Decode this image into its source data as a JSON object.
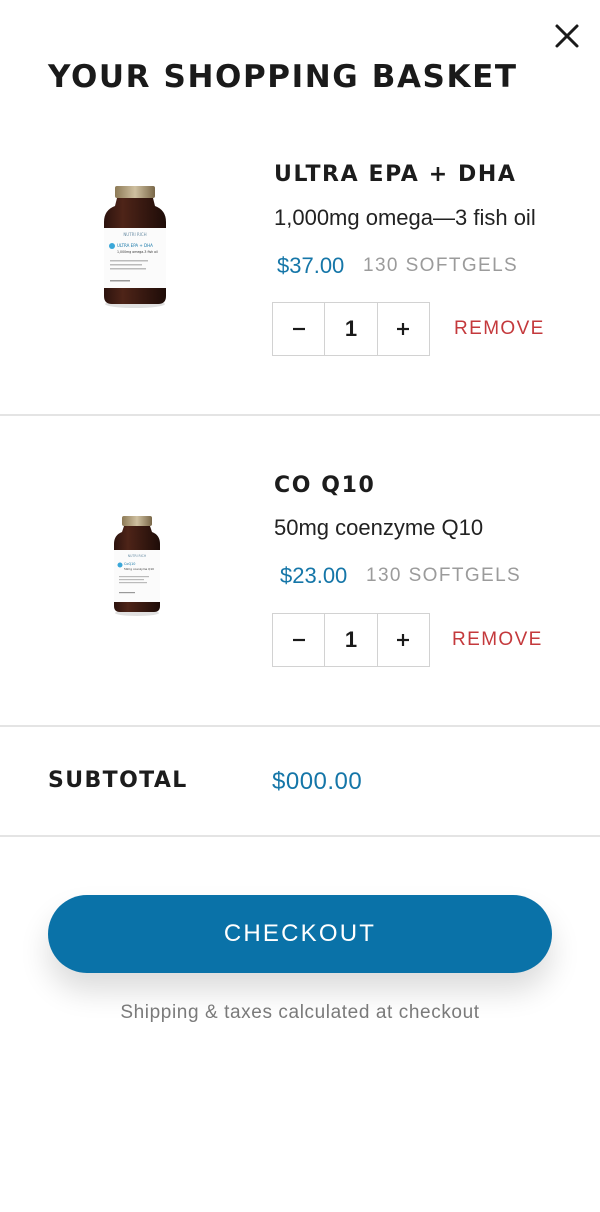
{
  "header": {
    "title": "YOUR SHOPPING BASKET",
    "close_icon": "close-icon"
  },
  "items": [
    {
      "name": "ULTRA EPA + DHA",
      "description": "1,000mg omega—3 fish oil",
      "price": "$37.00",
      "size": "130 SOFTGELS",
      "quantity": "1",
      "remove_label": "REMOVE",
      "image": {
        "brand": "NUTRI RICH",
        "label_name": "ULTRA EPA + DHA",
        "label_desc": "1,000mg omega-3 fish oil"
      }
    },
    {
      "name": "CO Q10",
      "description": "50mg coenzyme Q10",
      "price": "$23.00",
      "size": "130 SOFTGELS",
      "quantity": "1",
      "remove_label": "REMOVE",
      "image": {
        "brand": "NUTRI RICH",
        "label_name": "CoQ10",
        "label_desc": "50mg coenzyme Q10"
      }
    }
  ],
  "summary": {
    "subtotal_label": "SUBTOTAL",
    "subtotal_value": "$000.00"
  },
  "checkout": {
    "button_label": "CHECKOUT",
    "note": "Shipping & taxes calculated at checkout"
  },
  "colors": {
    "accent": "#0a72a8",
    "price": "#1576a8",
    "remove": "#c4393c",
    "muted": "#9b9b9b"
  }
}
